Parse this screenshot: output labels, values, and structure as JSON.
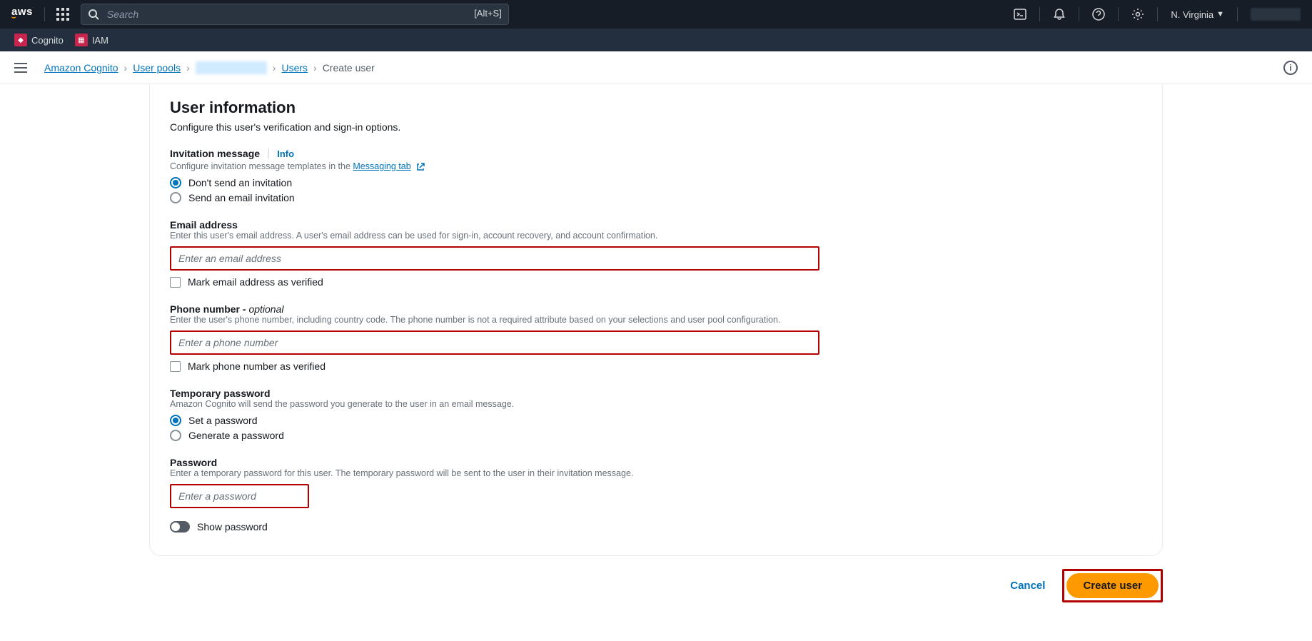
{
  "topnav": {
    "search_placeholder": "Search",
    "search_shortcut": "[Alt+S]",
    "region": "N. Virginia"
  },
  "servicenav": {
    "items": [
      "Cognito",
      "IAM"
    ]
  },
  "breadcrumb": {
    "items": [
      "Amazon Cognito",
      "User pools",
      "",
      "Users",
      "Create user"
    ]
  },
  "form": {
    "section_title": "User information",
    "section_desc": "Configure this user's verification and sign-in options.",
    "invitation": {
      "label": "Invitation message",
      "info": "Info",
      "help_prefix": "Configure invitation message templates in the ",
      "help_link": "Messaging tab",
      "opt1": "Don't send an invitation",
      "opt2": "Send an email invitation"
    },
    "email": {
      "label": "Email address",
      "help": "Enter this user's email address. A user's email address can be used for sign-in, account recovery, and account confirmation.",
      "placeholder": "Enter an email address",
      "verify": "Mark email address as verified"
    },
    "phone": {
      "label": "Phone number - ",
      "optional": "optional",
      "help": "Enter the user's phone number, including country code. The phone number is not a required attribute based on your selections and user pool configuration.",
      "placeholder": "Enter a phone number",
      "verify": "Mark phone number as verified"
    },
    "temp_pw": {
      "label": "Temporary password",
      "help": "Amazon Cognito will send the password you generate to the user in an email message.",
      "opt1": "Set a password",
      "opt2": "Generate a password"
    },
    "password": {
      "label": "Password",
      "help": "Enter a temporary password for this user. The temporary password will be sent to the user in their invitation message.",
      "placeholder": "Enter a password",
      "show": "Show password"
    }
  },
  "actions": {
    "cancel": "Cancel",
    "create": "Create user"
  }
}
